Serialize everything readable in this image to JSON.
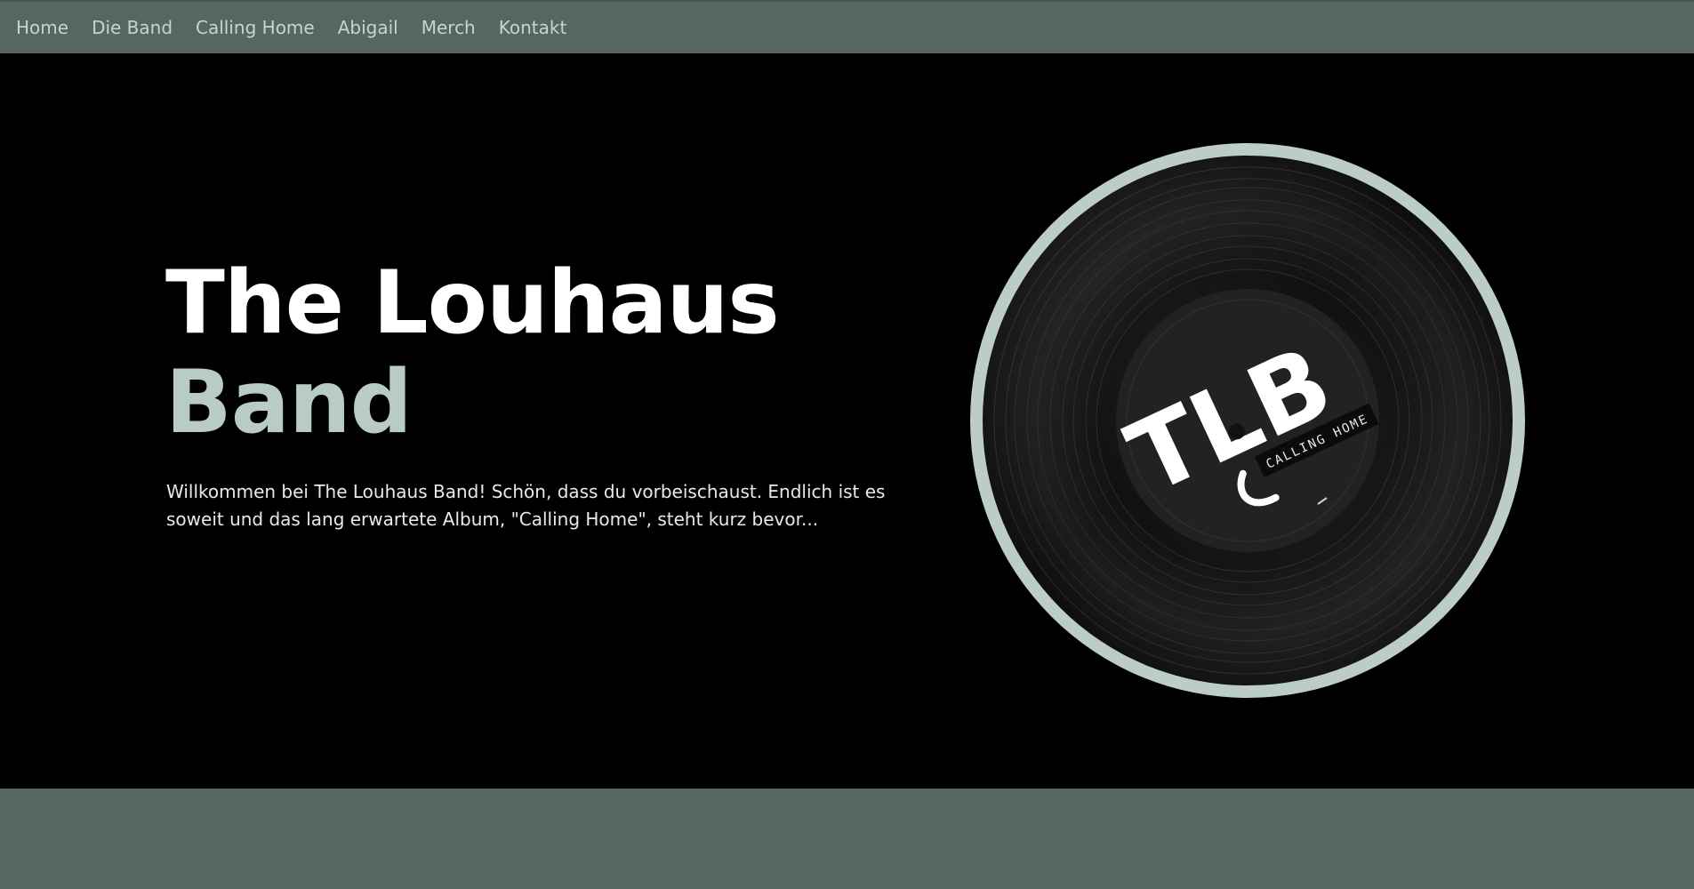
{
  "nav": {
    "items": [
      {
        "label": "Home"
      },
      {
        "label": "Die Band"
      },
      {
        "label": "Calling Home"
      },
      {
        "label": "Abigail"
      },
      {
        "label": "Merch"
      },
      {
        "label": "Kontakt"
      }
    ]
  },
  "hero": {
    "title_line1": "The Louhaus",
    "title_line2": "Band",
    "intro": "Willkommen bei The Louhaus Band! Schön, dass du vorbeischaust. Endlich ist es soweit und das lang erwartete Album, \"Calling Home\", steht kurz bevor..."
  },
  "record": {
    "logo_text": "TLB",
    "label_text": "CALLING HOME"
  },
  "colors": {
    "nav_bg": "#566661",
    "nav_text": "#c9d3cf",
    "hero_bg": "#000000",
    "accent": "#b8cbc5",
    "ring": "#bccdc8"
  }
}
